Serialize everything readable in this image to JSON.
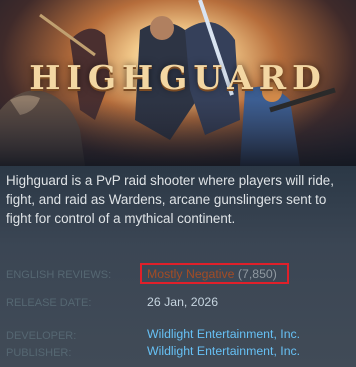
{
  "game": {
    "logo": "HIGHGUARD",
    "description": "Highguard is a PvP raid shooter where players will ride, fight, and raid as Wardens, arcane gunslingers sent to fight for control of a mythical continent."
  },
  "reviews": {
    "label": "ENGLISH REVIEWS:",
    "summary": "Mostly Negative",
    "count": "(7,850)",
    "summary_color": "#a34c25",
    "highlight_color": "#e0202a"
  },
  "release": {
    "label": "RELEASE DATE:",
    "value": "26 Jan, 2026"
  },
  "developer": {
    "label": "DEVELOPER:",
    "value": "Wildlight Entertainment, Inc."
  },
  "publisher": {
    "label": "PUBLISHER:",
    "value": "Wildlight Entertainment, Inc."
  },
  "colors": {
    "link": "#66c0f4",
    "background": "#3e4a57"
  }
}
